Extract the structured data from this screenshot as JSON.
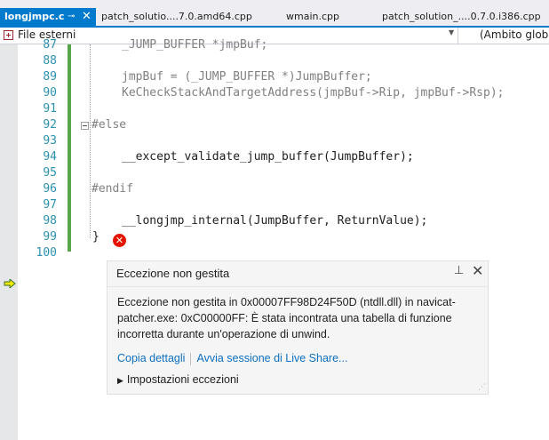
{
  "tabs": [
    {
      "label": "longjmpc.c",
      "active": true
    },
    {
      "label": "patch_solutio....7.0.amd64.cpp",
      "active": false
    },
    {
      "label": "wmain.cpp",
      "active": false
    },
    {
      "label": "patch_solution_....0.7.0.i386.cpp",
      "active": false
    }
  ],
  "navbar": {
    "scope_left": "File esterni",
    "scope_right": "(Ambito globale)"
  },
  "editor": {
    "lines": [
      {
        "num": "87",
        "text": "_JUMP_BUFFER *jmpBuf;"
      },
      {
        "num": "88",
        "text": ""
      },
      {
        "num": "89",
        "text": "jmpBuf = (_JUMP_BUFFER *)JumpBuffer;"
      },
      {
        "num": "90",
        "text": "KeCheckStackAndTargetAddress(jmpBuf->Rip, jmpBuf->Rsp);"
      },
      {
        "num": "91",
        "text": ""
      },
      {
        "num": "92",
        "text": "#else"
      },
      {
        "num": "93",
        "text": ""
      },
      {
        "num": "94",
        "text": "__except_validate_jump_buffer(JumpBuffer);"
      },
      {
        "num": "95",
        "text": ""
      },
      {
        "num": "96",
        "text": "#endif"
      },
      {
        "num": "97",
        "text": ""
      },
      {
        "num": "98",
        "text": "__longjmp_internal(JumpBuffer, ReturnValue);"
      },
      {
        "num": "99",
        "text": "}"
      },
      {
        "num": "100",
        "text": ""
      }
    ]
  },
  "exception": {
    "title": "Eccezione non gestita",
    "message": "Eccezione non gestita in 0x00007FF98D24F50D (ntdll.dll) in navicat-patcher.exe: 0xC00000FF: È stata incontrata una tabella di funzione incorretta durante un'operazione di unwind.",
    "copy_link": "Copia dettagli",
    "live_share_link": "Avvia sessione di Live Share...",
    "settings_label": "Impostazioni eccezioni"
  },
  "colors": {
    "accent": "#007acc",
    "error": "#e51400",
    "link": "#0e70c0",
    "line_number": "#2b91af"
  }
}
